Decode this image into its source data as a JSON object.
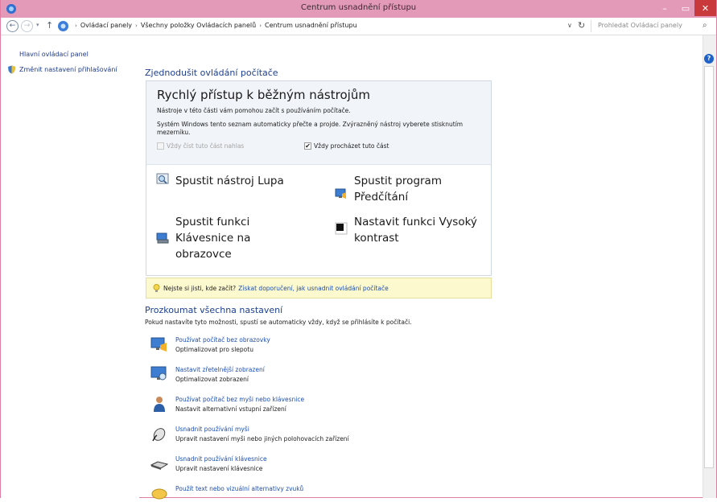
{
  "window": {
    "title": "Centrum usnadnění přístupu",
    "min_glyph": "–",
    "max_glyph": "▭",
    "close_glyph": "✕"
  },
  "address": {
    "back_glyph": "←",
    "forward_glyph": "→",
    "recent_glyph": "▾",
    "up_glyph": "↑",
    "crumbs": [
      "Ovládací panely",
      "Všechny položky Ovládacích panelů",
      "Centrum usnadnění přístupu"
    ],
    "separator": "›",
    "dropdown_glyph": "∨",
    "refresh_glyph": "↻",
    "search_placeholder": "Prohledat Ovládací panely",
    "search_glyph": "⌕"
  },
  "leftpane": {
    "home_link": "Hlavní ovládací panel",
    "change_login": "Změnit nastavení přihlašování"
  },
  "main": {
    "simplify_heading": "Zjednodušit ovládání počítače",
    "quick": {
      "title": "Rychlý přístup k běžným nástrojům",
      "subtitle": "Nástroje v této části vám pomohou začít s používáním počítače.",
      "description": "Systém Windows tento seznam automaticky přečte a projde. Zvýrazněný nástroj vyberete stisknutím mezerníku.",
      "check_read": "Vždy číst tuto část nahlas",
      "check_scan": "Vždy procházet tuto část",
      "check_scan_mark": "✔",
      "tools": [
        {
          "label": "Spustit nástroj Lupa",
          "icon": "magnifier-icon"
        },
        {
          "label": "Spustit program Předčítání",
          "icon": "narrator-icon"
        },
        {
          "label": "Spustit funkci Klávesnice na obrazovce",
          "icon": "keyboard-icon"
        },
        {
          "label": "Nastavit funkci Vysoký kontrast",
          "icon": "contrast-icon"
        }
      ]
    },
    "tip": {
      "question": "Nejste si jisti, kde začít?",
      "link": "Získat doporučení, jak usnadnit ovládání počítače"
    },
    "explore_heading": "Prozkoumat všechna nastavení",
    "explore_sub": "Pokud nastavíte tyto možnosti, spustí se automaticky vždy, když se přihlásíte k počítači.",
    "settings": [
      {
        "link": "Používat počítač bez obrazovky",
        "desc": "Optimalizovat pro slepotu",
        "icon": "monitor-narrator-icon"
      },
      {
        "link": "Nastavit zřetelnější zobrazení",
        "desc": "Optimalizovat zobrazení",
        "icon": "display-icon"
      },
      {
        "link": "Používat počítač bez myši nebo klávesnice",
        "desc": "Nastavit alternativní vstupní zařízení",
        "icon": "user-input-icon"
      },
      {
        "link": "Usnadnit používání myši",
        "desc": "Upravit nastavení myši nebo jiných polohovacích zařízení",
        "icon": "mouse-icon"
      },
      {
        "link": "Usnadnit používání klávesnice",
        "desc": "Upravit nastavení klávesnice",
        "icon": "keyboard-settings-icon"
      },
      {
        "link": "Použít text nebo vizuální alternativy zvuků",
        "desc": "",
        "icon": "sound-alternatives-icon"
      }
    ]
  },
  "help_glyph": "?",
  "colors": {
    "titlebar": "#e39ab8",
    "close": "#c9383a",
    "link": "#1e4fb0",
    "heading": "#1c3f8f",
    "tip_bg": "#fcf9cf"
  }
}
